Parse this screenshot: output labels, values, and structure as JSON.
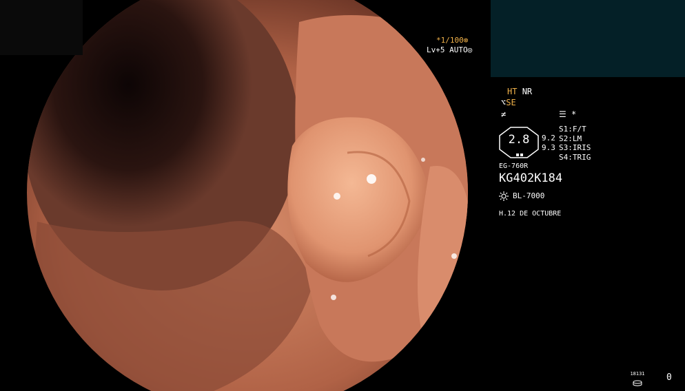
{
  "overlay": {
    "magnification": "*1/100",
    "magnification_icon": "crossed-circle-icon",
    "level": "Lv+5",
    "auto": "AUTO",
    "auto_icon": "concentric-circle-icon",
    "ht": "HT",
    "nr": "NR",
    "se": "SE",
    "fx_icon": "f-slash-icon",
    "menu_icon": "menu-icon",
    "asterisk": "*",
    "zoom_value": "2.8",
    "sub_value_1": "9.2",
    "sub_value_2": "9.3",
    "s_modes": [
      {
        "key": "S1",
        "value": "F/T"
      },
      {
        "key": "S2",
        "value": "LM"
      },
      {
        "key": "S3",
        "value": "IRIS"
      },
      {
        "key": "S4",
        "value": "TRIG"
      }
    ],
    "scope_model": "EG-760R",
    "scope_serial": "KG402K184",
    "light_icon": "sun-icon",
    "light_source": "BL-7000",
    "date": "H.12 DE OCTUBRE",
    "recorder_small": "18131",
    "recorder_count": "0"
  },
  "colors": {
    "accent_orange": "#f1b24a",
    "preview_bg": "#042027",
    "mucosa": "#c97a5c",
    "polyp": "#e9a078"
  }
}
